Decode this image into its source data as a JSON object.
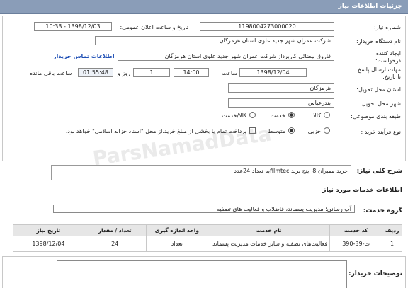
{
  "header": {
    "title": "جزئیات اطلاعات نیاز"
  },
  "form": {
    "need_number_label": "شماره نیاز:",
    "need_number": "1198004273000020",
    "announce_label": "تاریخ و ساعت اعلان عمومی:",
    "announce_value": "1398/12/03 - 10:33",
    "buyer_org_label": "نام دستگاه خریدار:",
    "buyer_org": "شرکت عمران شهر جدید علوی استان هرمزگان",
    "creator_label_1": "ایجاد کننده",
    "creator_label_2": "درخواست:",
    "creator": "فاروق  بیضائی کاربرداز شرکت عمران شهر جدید علوی استان هرمزگان",
    "contact_link": "اطلاعات تماس خریدار",
    "deadline_label_1": "مهلت ارسال پاسخ:",
    "deadline_label_2": "تا تاریخ:",
    "deadline_date": "1398/12/04",
    "time_label": "ساعت",
    "deadline_time": "14:00",
    "days_value": "1",
    "days_label": "روز و",
    "remaining_value": "01:55:48",
    "remaining_label": "ساعت باقی مانده",
    "province_label": "استان محل تحویل:",
    "province": "هرمزگان",
    "city_label": "شهر محل تحویل:",
    "city": "بندرعباس",
    "category_label": "طبقه بندی موضوعی:",
    "category_options": [
      "کالا",
      "خدمت",
      "کالا/خدمت"
    ],
    "category_selected": "خدمت",
    "process_label": "نوع فرآیند خرید :",
    "process_options": [
      "جزیی",
      "متوسط"
    ],
    "process_selected": "متوسط",
    "payment_note": "پرداخت تمام یا بخشی از مبلغ خرید،از محل \"اسناد خزانه اسلامی\" خواهد بود."
  },
  "summary": {
    "label": "شرح کلی نیاز:",
    "value": "خرید ممبران 8 اینچ برند filmtecبه تعداد 24عدد"
  },
  "services": {
    "section_title": "اطلاعات خدمات مورد نیاز",
    "group_label": "گروه خدمت:",
    "group_value": "آب رسانی؛ مدیریت پسماند، فاضلاب و فعالیت های تصفیه",
    "columns": [
      "ردیف",
      "کد خدمت",
      "نام خدمت",
      "واحد اندازه گیری",
      "تعداد / مقدار",
      "تاریخ نیاز"
    ],
    "rows": [
      [
        "1",
        "ث-39-390",
        "فعالیت‌های تصفیه و سایر خدمات مدیریت پسماند",
        "تعداد",
        "24",
        "1398/12/04"
      ]
    ]
  },
  "notes": {
    "label": "توضیحات خریدار:",
    "value": ""
  },
  "watermark": "ParsNamadData"
}
